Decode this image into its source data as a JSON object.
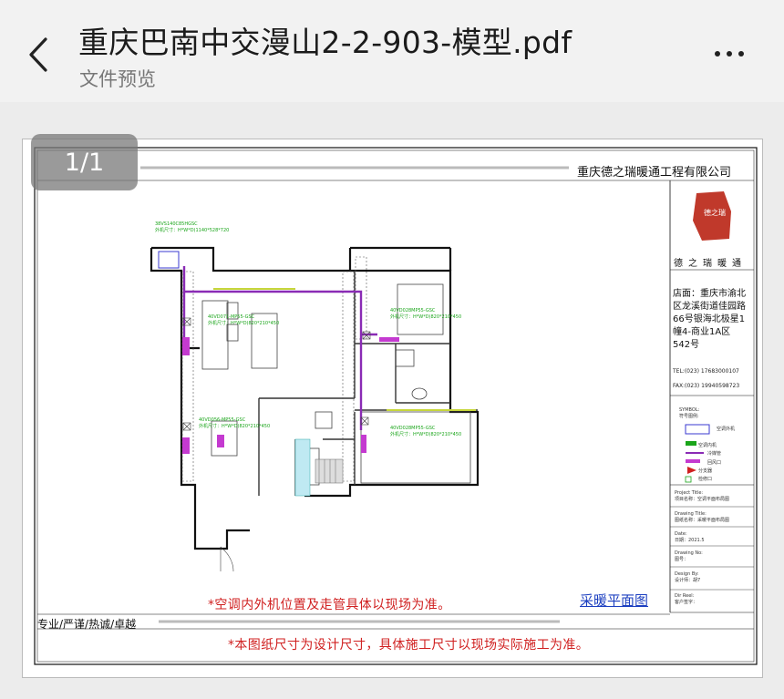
{
  "header": {
    "title": "重庆巴南中交漫山2-2-903-模型.pdf",
    "subtitle": "文件预览"
  },
  "viewer": {
    "page_indicator": "1/1"
  },
  "drawing": {
    "company_top": "重庆德之瑞暖通工程有限公司",
    "logo_seal": "德之瑞",
    "logo_text": "德之瑞暖通",
    "store_info": "店面：重庆市渝北区龙溪街道佳园路66号银海北极星1幢4-商业1A区542号",
    "tel": "TEL:(023) 17683000107",
    "fax": "FAX:(023) 19940598723",
    "legend": {
      "title": "SYMBOL:",
      "subtitle": "符号图例:",
      "items": [
        {
          "label": "空调外机",
          "color": "#3a3ad0"
        },
        {
          "label": "空调内机",
          "color": "#1aa51a"
        },
        {
          "label": "冷媒管",
          "color": "#8a2bb5"
        },
        {
          "label": "回风口",
          "color": "#c43ad0"
        },
        {
          "label": "分支器",
          "color": "#d02020"
        },
        {
          "label": "检修口",
          "color": "#1aa51a"
        }
      ]
    },
    "title_block": {
      "project_title": "Project Title:",
      "project_name": "项目名称：空调平面布局图",
      "drawing_title": "Drawing Title:",
      "drawing_name": "图纸名称：采暖平面布局图",
      "date_label": "Date:",
      "date_value": "日期：2021.5",
      "drawing_no": "Drawing No:",
      "drawing_no_value": "图号：",
      "design_by": "Design By:",
      "design_by_value": "设计师：胡7",
      "dir_reel": "Dir Reel:",
      "dir_reel_value": "客户签字："
    },
    "ac_units": [
      {
        "model": "38VS140C85HGSC",
        "size": "外机尺寸：H*W*D)1140*528*720"
      },
      {
        "model": "40VD071-MP55-GSC",
        "size": "外机尺寸：H*W*D)820*210*450"
      },
      {
        "model": "40VD028MP55-GSC",
        "size": "外机尺寸：H*W*D)820*210*450"
      },
      {
        "model": "40VD056-MP55-GSC",
        "size": "外机尺寸：H*W*D)820*210*450"
      },
      {
        "model": "40VD028MP55-GSC",
        "size": "外机尺寸：H*W*D)820*210*450"
      }
    ],
    "note1": "*空调内外机位置及走管具体以现场为准。",
    "note2": "*本图纸尺寸为设计尺寸，具体施工尺寸以现场实际施工为准。",
    "plan_name": "采暖平面图",
    "slogan": "专业/严谨/热诚/卓越"
  }
}
